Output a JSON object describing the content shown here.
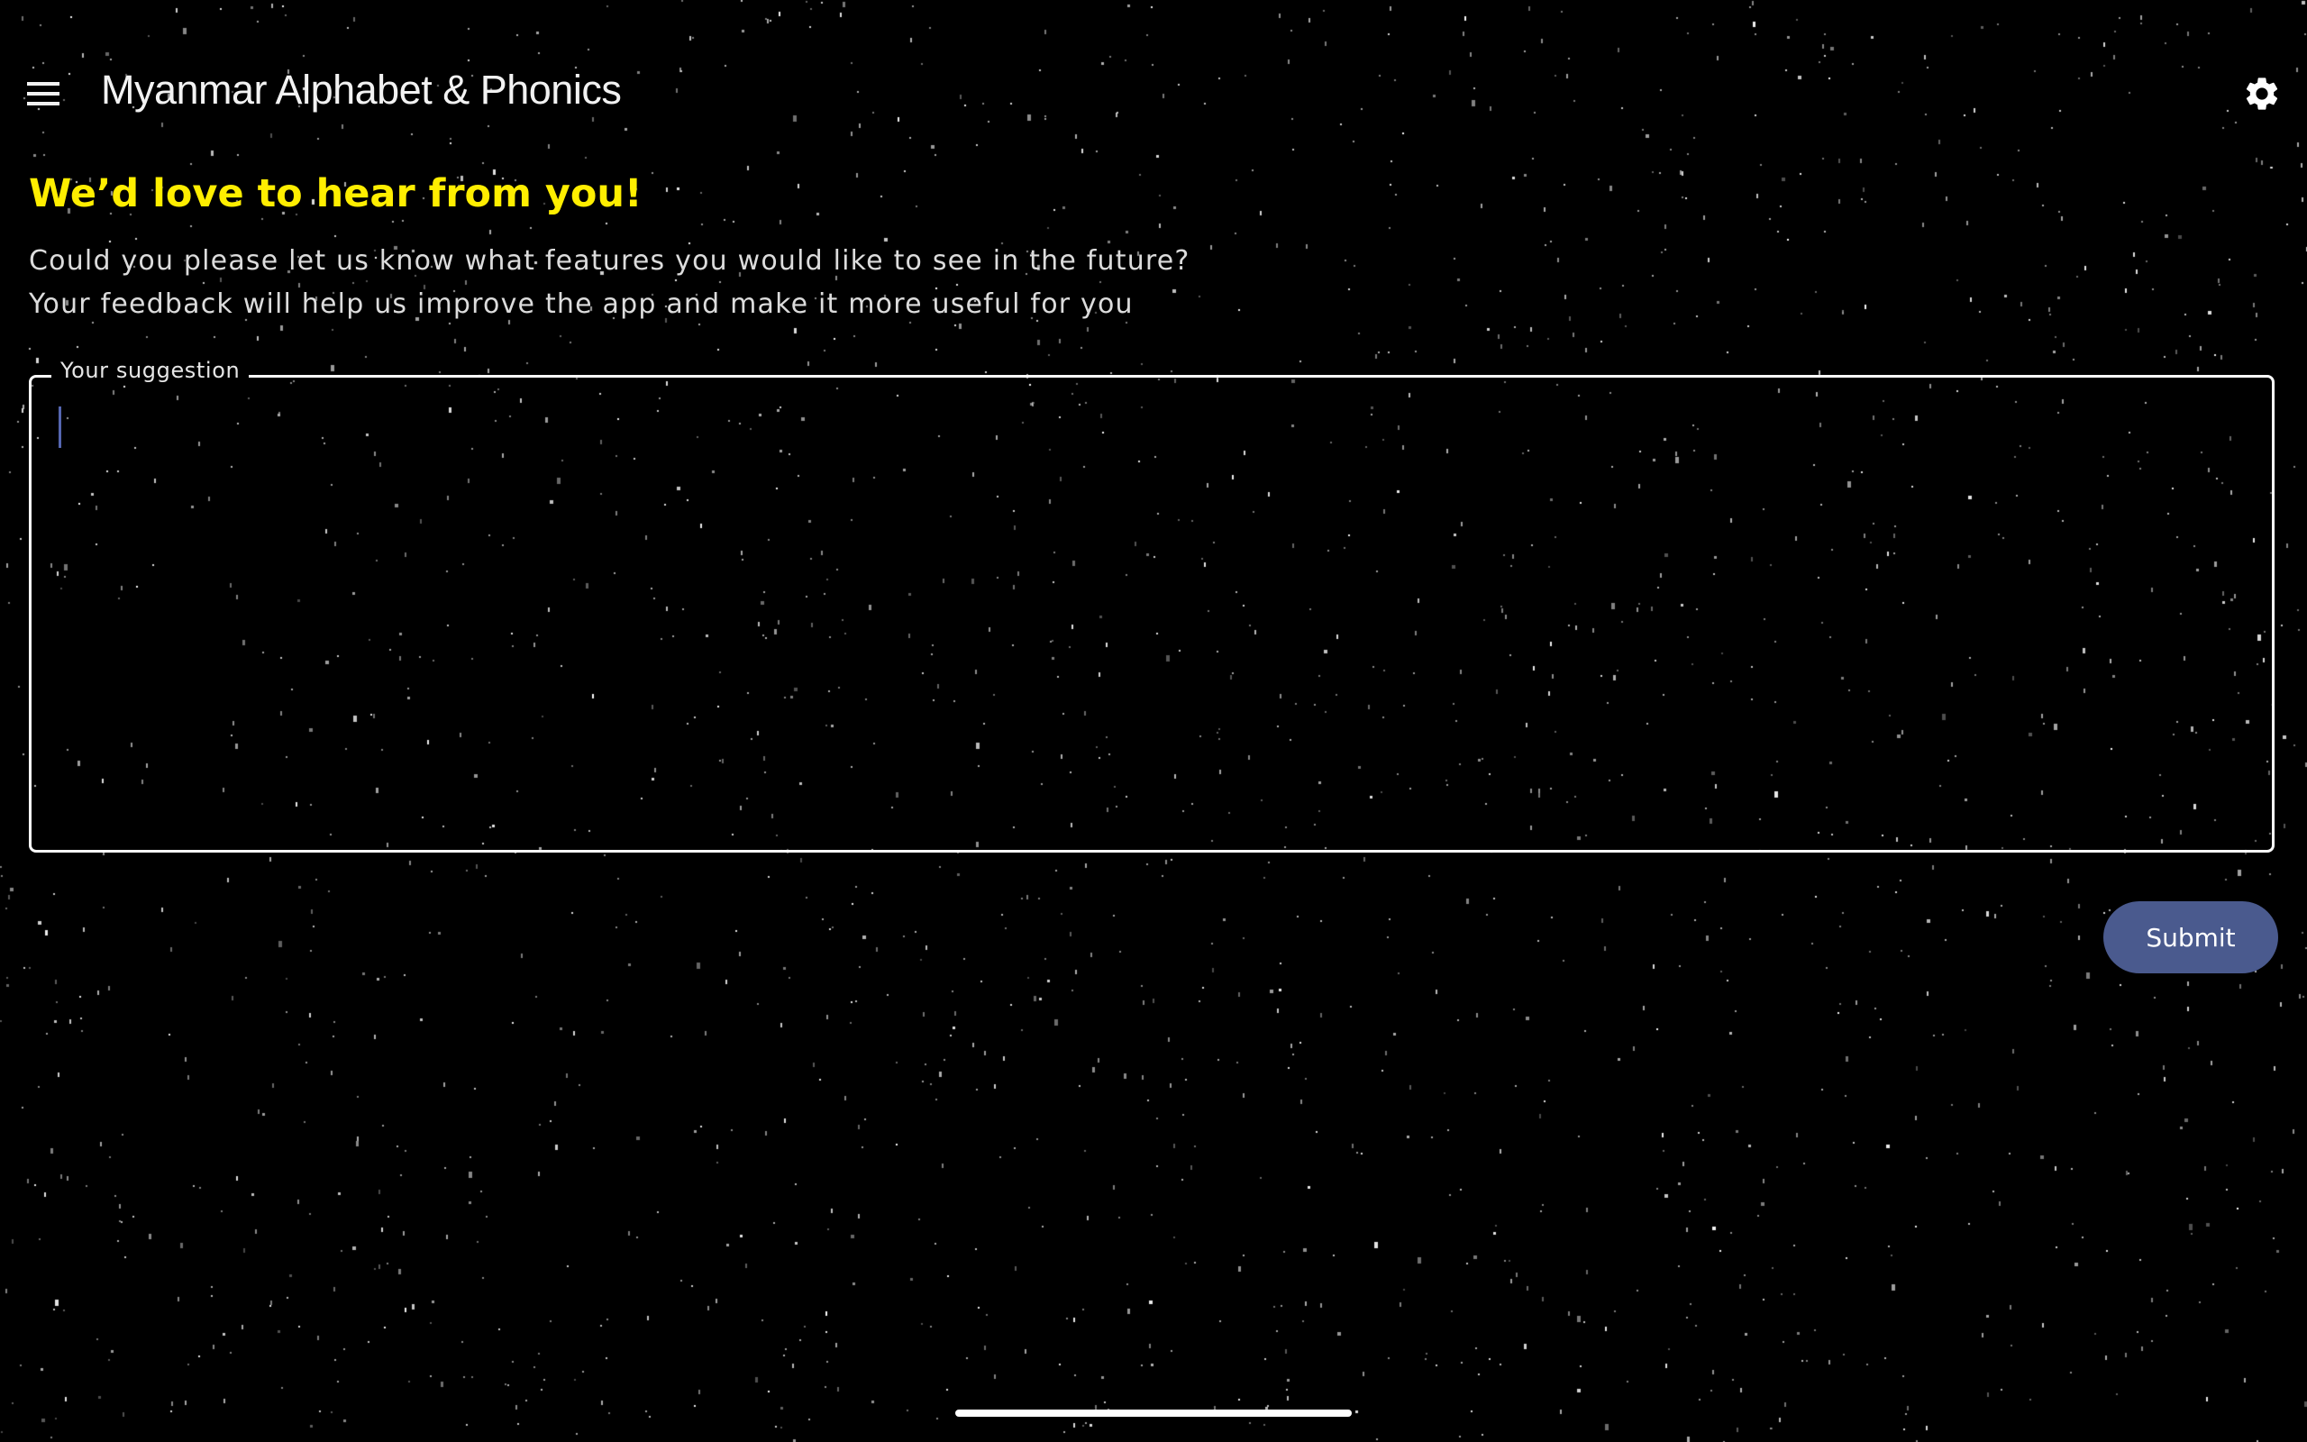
{
  "app_bar": {
    "title": "Myanmar Alphabet & Phonics",
    "menu_icon": "hamburger-menu-icon",
    "settings_icon": "gear-icon"
  },
  "feedback": {
    "heading": "We’d love to hear from you!",
    "description_line_1": "Could you please let us know what features you would like to see in the future?",
    "description_line_2": "Your feedback will help us improve the app and make it more useful for you",
    "suggestion_label": "Your suggestion",
    "suggestion_value": "",
    "submit_label": "Submit"
  },
  "colors": {
    "background": "#000000",
    "heading": "#ffee00",
    "accent": "#4a5a8e",
    "text": "#dcdcdc",
    "border": "#ffffff"
  }
}
